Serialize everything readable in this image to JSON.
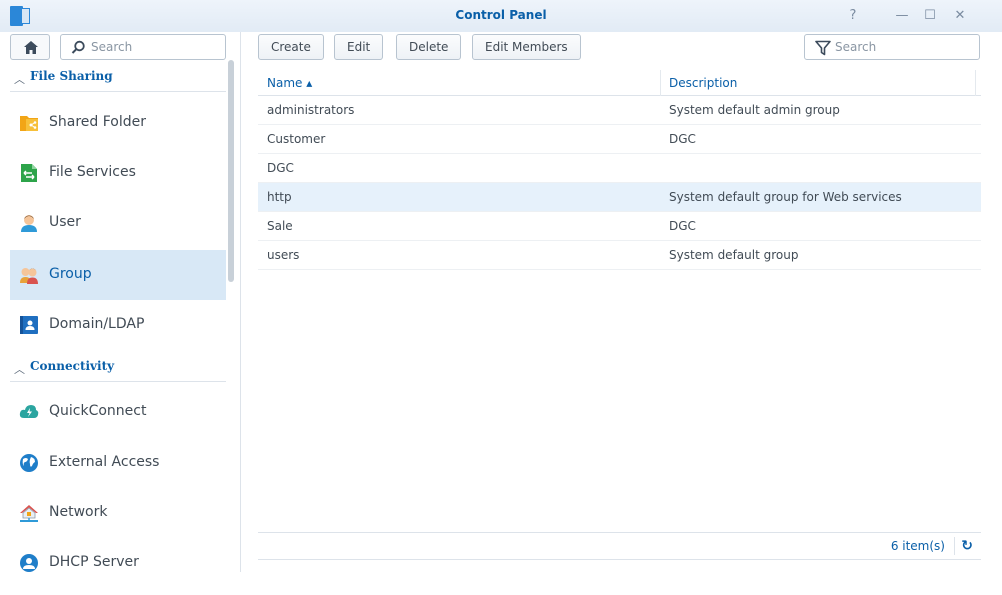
{
  "window": {
    "title": "Control Panel",
    "controls": {
      "help": "?",
      "minimize": "—",
      "maximize": "☐",
      "close": "✕"
    }
  },
  "sidebar": {
    "search_placeholder": "Search",
    "sections": [
      {
        "label": "File Sharing",
        "items": [
          {
            "label": "Shared Folder",
            "icon": "shared-folder-icon"
          },
          {
            "label": "File Services",
            "icon": "file-services-icon"
          },
          {
            "label": "User",
            "icon": "user-icon"
          },
          {
            "label": "Group",
            "icon": "group-icon",
            "active": true
          },
          {
            "label": "Domain/LDAP",
            "icon": "domain-ldap-icon"
          }
        ]
      },
      {
        "label": "Connectivity",
        "items": [
          {
            "label": "QuickConnect",
            "icon": "quickconnect-icon"
          },
          {
            "label": "External Access",
            "icon": "external-access-icon"
          },
          {
            "label": "Network",
            "icon": "network-icon"
          },
          {
            "label": "DHCP Server",
            "icon": "dhcp-server-icon"
          }
        ]
      }
    ]
  },
  "toolbar": {
    "create": "Create",
    "edit": "Edit",
    "delete": "Delete",
    "edit_members": "Edit Members",
    "filter_placeholder": "Search"
  },
  "table": {
    "columns": {
      "name": "Name ▴",
      "description": "Description"
    },
    "rows": [
      {
        "name": "administrators",
        "description": "System default admin group"
      },
      {
        "name": "Customer",
        "description": "DGC"
      },
      {
        "name": "DGC",
        "description": ""
      },
      {
        "name": "http",
        "description": "System default group for Web services",
        "selected": true
      },
      {
        "name": "Sale",
        "description": "DGC"
      },
      {
        "name": "users",
        "description": "System default group"
      }
    ]
  },
  "footer": {
    "count": "6 item(s)",
    "refresh_icon": "refresh-icon"
  },
  "colors": {
    "accent": "#0a5fa8",
    "selected_nav": "#d8e8f6",
    "selected_row": "#e6f1fb"
  }
}
